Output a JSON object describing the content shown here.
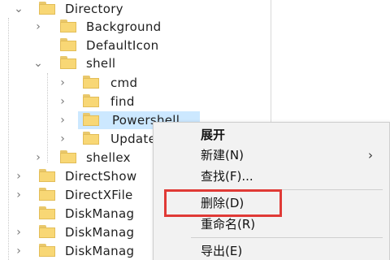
{
  "tree": {
    "items": [
      {
        "label": "Directory",
        "expanded": true
      },
      {
        "label": "Background",
        "expanded": false
      },
      {
        "label": "DefaultIcon",
        "expanded": false
      },
      {
        "label": "shell",
        "expanded": true
      },
      {
        "label": "cmd",
        "expanded": false
      },
      {
        "label": "find",
        "expanded": false
      },
      {
        "label": "Powershell",
        "expanded": false,
        "selected": true
      },
      {
        "label": "Update",
        "expanded": false
      },
      {
        "label": "shellex",
        "expanded": false
      },
      {
        "label": "DirectShow",
        "expanded": false
      },
      {
        "label": "DirectXFile",
        "expanded": false
      },
      {
        "label": "DiskManag",
        "expanded": false
      },
      {
        "label": "DiskManag",
        "expanded": false
      },
      {
        "label": "DiskManag",
        "expanded": false
      }
    ]
  },
  "context_menu": {
    "items": [
      {
        "label": "展开",
        "bold": true
      },
      {
        "label": "新建(N)",
        "submenu": true
      },
      {
        "label": "查找(F)..."
      },
      {
        "label": "删除(D)",
        "highlighted": true
      },
      {
        "label": "重命名(R)"
      },
      {
        "label": "导出(E)"
      }
    ]
  },
  "colors": {
    "selection": "#cce8ff",
    "folder": "#f8d775",
    "highlight_box": "#e03a36",
    "menu_bg": "#f2f2f2"
  },
  "icons": {
    "expanded": "chevron-down-icon",
    "collapsed": "chevron-right-icon",
    "folder": "folder-icon",
    "submenu": "submenu-arrow-icon"
  }
}
